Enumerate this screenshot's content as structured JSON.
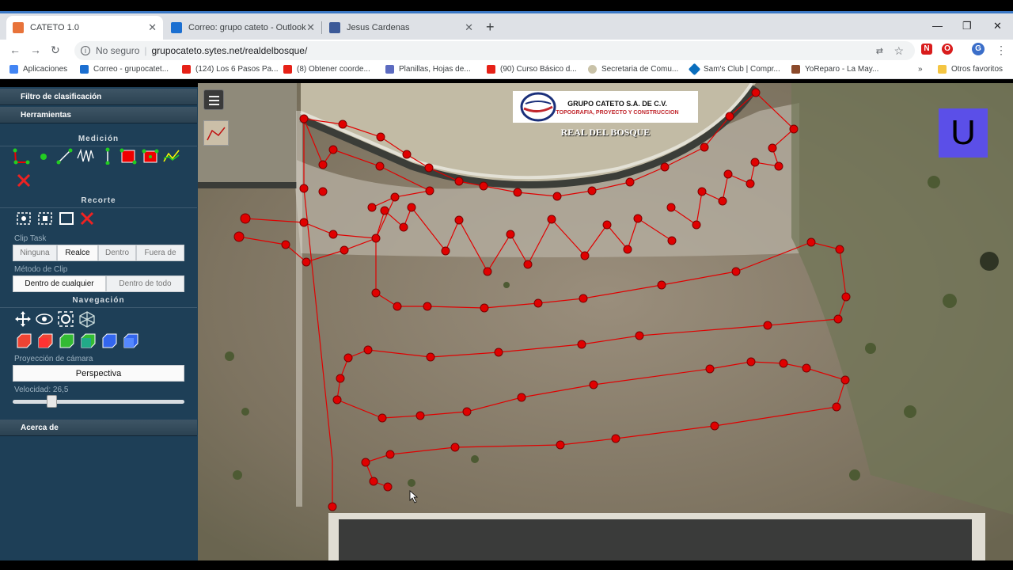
{
  "browser": {
    "tabs": [
      {
        "label": "CATETO 1.0",
        "icon": "cateto-favicon",
        "color": "#e8733a"
      },
      {
        "label": "Correo: grupo cateto - Outlook",
        "icon": "outlook-favicon",
        "color": "#1b6fd1"
      },
      {
        "label": "Jesus Cardenas",
        "icon": "facebook-favicon",
        "color": "#3b5998"
      }
    ],
    "new_tab": "+",
    "window_controls": {
      "minimize": "—",
      "maximize": "❐",
      "close": "✕"
    },
    "address": {
      "security": "No seguro",
      "url": "grupocateto.sytes.net/realdelbosque/"
    },
    "profile_initial": "G",
    "bookmarks": [
      {
        "label": "Aplicaciones",
        "color": "#4285f4"
      },
      {
        "label": "Correo - grupocatet...",
        "color": "#1b6fd1"
      },
      {
        "label": "(124) Los 6 Pasos Pa...",
        "color": "#e62117"
      },
      {
        "label": "(8) Obtener coorde...",
        "color": "#e62117"
      },
      {
        "label": "Planillas, Hojas de...",
        "color": "#5c6bc0"
      },
      {
        "label": "(90) Curso Básico d...",
        "color": "#e62117"
      },
      {
        "label": "Secretaria de Comu...",
        "color": "#c9c2a8"
      },
      {
        "label": "Sam's Club | Compr...",
        "color": "#0a6ebd"
      },
      {
        "label": "YoReparo - La May...",
        "color": "#8b4a2b"
      },
      {
        "label": "Otros favoritos",
        "color": "#f4c542"
      }
    ],
    "bookmarks_more": "»"
  },
  "sidebar": {
    "menu_top": [
      "Filtro de clasificación",
      "Herramientas"
    ],
    "medicion_title": "Medición",
    "recorte_title": "Recorte",
    "clip_task_label": "Clip Task",
    "clip_task_options": [
      "Ninguna",
      "Realce",
      "Dentro",
      "Fuera de"
    ],
    "clip_task_selected": "Realce",
    "clip_method_label": "Método de Clip",
    "clip_method_options": [
      "Dentro de cualquier",
      "Dentro de todo"
    ],
    "clip_method_selected": "Dentro de cualquier",
    "navegacion_title": "Navegación",
    "projection_label": "Proyección de cámara",
    "projection_value": "Perspectiva",
    "speed_label": "Velocidad: 26,5",
    "speed_level": 0.24,
    "about": "Acerca de"
  },
  "viewer": {
    "logo_title": "GRUPO CATETO S.A. DE C.V.",
    "logo_subtitle": "TOPOGRAFIA, PROYECTO Y CONSTRUCCION",
    "site_title": "REAL DEL BOSQUE",
    "badge": "U",
    "measure_color": "#e00000"
  }
}
